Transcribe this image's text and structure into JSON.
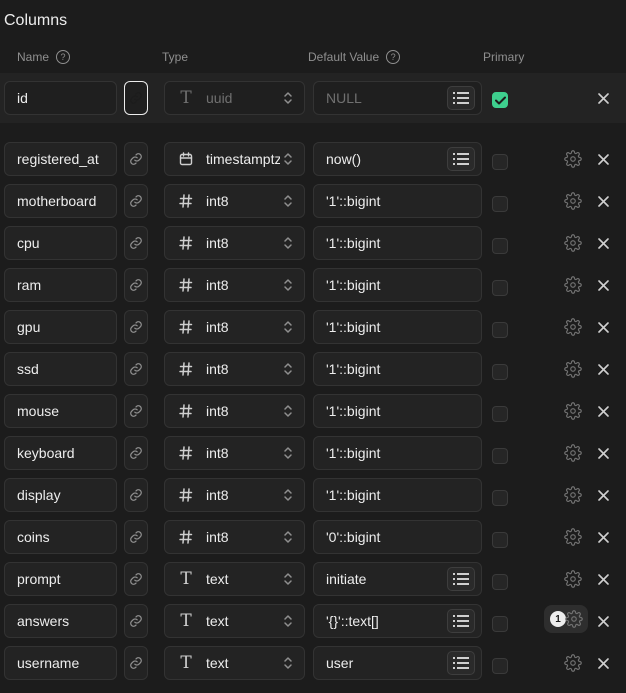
{
  "section_title": "Columns",
  "headers": {
    "name": "Name",
    "type": "Type",
    "default": "Default Value",
    "primary": "Primary"
  },
  "accent_color": "#3ecf8e",
  "primary_column": {
    "name": "id",
    "type_icon": "text-type-icon",
    "type": "uuid",
    "default_placeholder": "NULL",
    "primary": true
  },
  "columns": [
    {
      "name": "registered_at",
      "type_icon": "calendar-icon",
      "type": "timestamptz",
      "default": "now()",
      "has_list": true
    },
    {
      "name": "motherboard",
      "type_icon": "hash-icon",
      "type": "int8",
      "default": "'1'::bigint",
      "has_list": false
    },
    {
      "name": "cpu",
      "type_icon": "hash-icon",
      "type": "int8",
      "default": "'1'::bigint",
      "has_list": false
    },
    {
      "name": "ram",
      "type_icon": "hash-icon",
      "type": "int8",
      "default": "'1'::bigint",
      "has_list": false
    },
    {
      "name": "gpu",
      "type_icon": "hash-icon",
      "type": "int8",
      "default": "'1'::bigint",
      "has_list": false
    },
    {
      "name": "ssd",
      "type_icon": "hash-icon",
      "type": "int8",
      "default": "'1'::bigint",
      "has_list": false
    },
    {
      "name": "mouse",
      "type_icon": "hash-icon",
      "type": "int8",
      "default": "'1'::bigint",
      "has_list": false
    },
    {
      "name": "keyboard",
      "type_icon": "hash-icon",
      "type": "int8",
      "default": "'1'::bigint",
      "has_list": false
    },
    {
      "name": "display",
      "type_icon": "hash-icon",
      "type": "int8",
      "default": "'1'::bigint",
      "has_list": false
    },
    {
      "name": "coins",
      "type_icon": "hash-icon",
      "type": "int8",
      "default": "'0'::bigint",
      "has_list": false
    },
    {
      "name": "prompt",
      "type_icon": "text-type-icon",
      "type": "text",
      "default": "initiate",
      "has_list": true
    },
    {
      "name": "answers",
      "type_icon": "text-type-icon",
      "type": "text",
      "default": "'{}'::text[]",
      "has_list": true,
      "badge": "1"
    },
    {
      "name": "username",
      "type_icon": "text-type-icon",
      "type": "text",
      "default": "user",
      "has_list": true
    }
  ]
}
